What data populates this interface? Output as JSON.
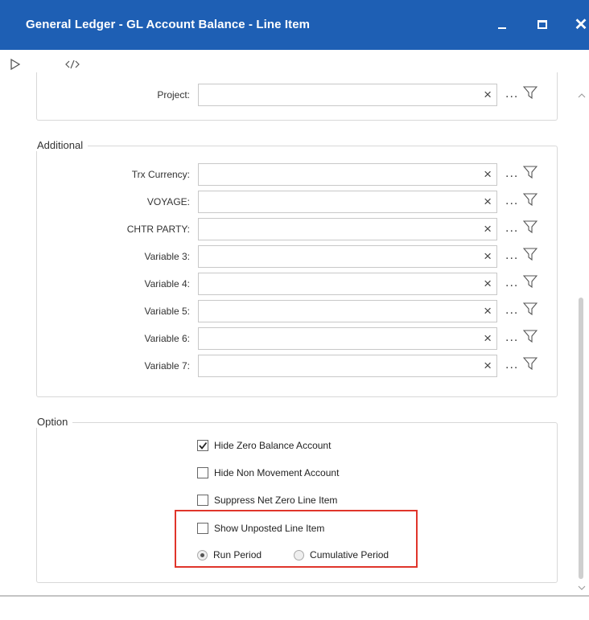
{
  "window": {
    "title": "General Ledger - GL Account Balance - Line Item",
    "accent": "#1e5fb4"
  },
  "toolbar": {
    "icons": [
      "run-icon",
      "code-icon"
    ]
  },
  "top_group": {
    "rows": [
      {
        "label": "Project:",
        "value": "",
        "placeholder": ""
      }
    ]
  },
  "additional": {
    "legend": "Additional",
    "rows": [
      {
        "label": "Trx Currency:",
        "value": ""
      },
      {
        "label": "VOYAGE:",
        "value": ""
      },
      {
        "label": "CHTR PARTY:",
        "value": ""
      },
      {
        "label": "Variable 3:",
        "value": ""
      },
      {
        "label": "Variable 4:",
        "value": ""
      },
      {
        "label": "Variable 5:",
        "value": ""
      },
      {
        "label": "Variable 6:",
        "value": ""
      },
      {
        "label": "Variable 7:",
        "value": ""
      }
    ]
  },
  "option": {
    "legend": "Option",
    "checkboxes": [
      {
        "label": "Hide Zero Balance Account",
        "checked": true
      },
      {
        "label": "Hide Non Movement Account",
        "checked": false
      },
      {
        "label": "Suppress Net Zero Line Item",
        "checked": false
      },
      {
        "label": "Show Unposted Line Item",
        "checked": false
      }
    ],
    "radios": [
      {
        "label": "Run Period",
        "selected": true
      },
      {
        "label": "Cumulative Period",
        "selected": false
      }
    ]
  },
  "field_actions": {
    "clear": "×",
    "lookup": "..."
  },
  "highlight_color": "#e0352b"
}
